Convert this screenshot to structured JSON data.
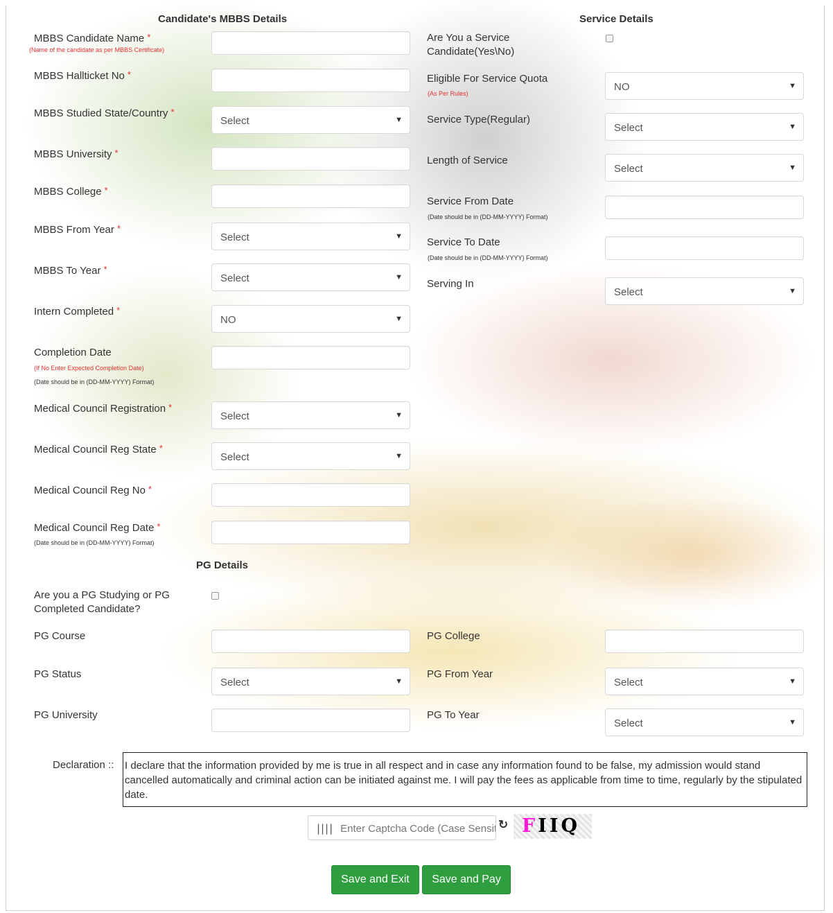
{
  "mbbs": {
    "title": "Candidate's MBBS Details",
    "candidate_name": "MBBS Candidate Name",
    "candidate_name_note": "(Name of the candidate as per MBBS Certificate)",
    "hallticket": "MBBS Hallticket No",
    "studied_state": "MBBS Studied State/Country",
    "studied_state_value": "Select",
    "university": "MBBS University",
    "college": "MBBS College",
    "from_year": "MBBS From Year",
    "from_year_value": "Select",
    "to_year": "MBBS To Year",
    "to_year_value": "Select",
    "intern": "Intern Completed",
    "intern_value": "NO",
    "completion_date": "Completion Date",
    "completion_note_red": "(If No Enter Expected Completion Date)",
    "completion_note": "(Date should be in (DD-MM-YYYY) Format)",
    "mc_registration": "Medical Council Registration",
    "mc_registration_value": "Select",
    "mc_reg_state": "Medical Council Reg State",
    "mc_reg_state_value": "Select",
    "mc_reg_no": "Medical Council Reg No",
    "mc_reg_date": "Medical Council Reg Date",
    "mc_reg_date_note": "(Date should be in (DD-MM-YYYY) Format)"
  },
  "service": {
    "title": "Service Details",
    "is_service_line1": "Are You a Service",
    "is_service_line2": "Candidate(Yes\\No)",
    "eligible_quota": "Eligible For Service Quota",
    "eligible_quota_note": "(As Per Rules)",
    "eligible_quota_value": "NO",
    "service_type": "Service Type(Regular)",
    "service_type_value": "Select",
    "length": "Length of Service",
    "length_value": "Select",
    "from_date": "Service From Date",
    "from_date_note": "(Date should be in (DD-MM-YYYY) Format)",
    "to_date": "Service To Date",
    "to_date_note": "(Date should be in (DD-MM-YYYY) Format)",
    "serving_in": "Serving In",
    "serving_in_value": "Select"
  },
  "pg": {
    "title": "PG Details",
    "question_line1": "Are you a PG Studying or PG",
    "question_line2": "Completed Candidate?",
    "course": "PG Course",
    "college": "PG College",
    "status": "PG Status",
    "status_value": "Select",
    "from_year": "PG From Year",
    "from_year_value": "Select",
    "university": "PG University",
    "to_year": "PG To Year",
    "to_year_value": "Select"
  },
  "required_mark": "*",
  "declaration": {
    "label": "Declaration ::",
    "text": "I declare that the information provided by me is true in all respect and in case any information found to be false, my admission would stand cancelled automatically and criminal action can be initiated against me. I will pay the fees as applicable from time to time, regularly by the stipulated date."
  },
  "captcha": {
    "barcode_glyph": "||||",
    "placeholder": "Enter Captcha Code (Case Sensitive)",
    "refresh_glyph": "↻",
    "chars": [
      "F",
      "I",
      "I",
      "Q"
    ],
    "char_colors": [
      "#ff1ad9",
      "#000000",
      "#000000",
      "#000000"
    ]
  },
  "buttons": {
    "save_exit": "Save and Exit",
    "save_pay": "Save and Pay",
    "color": "#2f9e3f"
  }
}
